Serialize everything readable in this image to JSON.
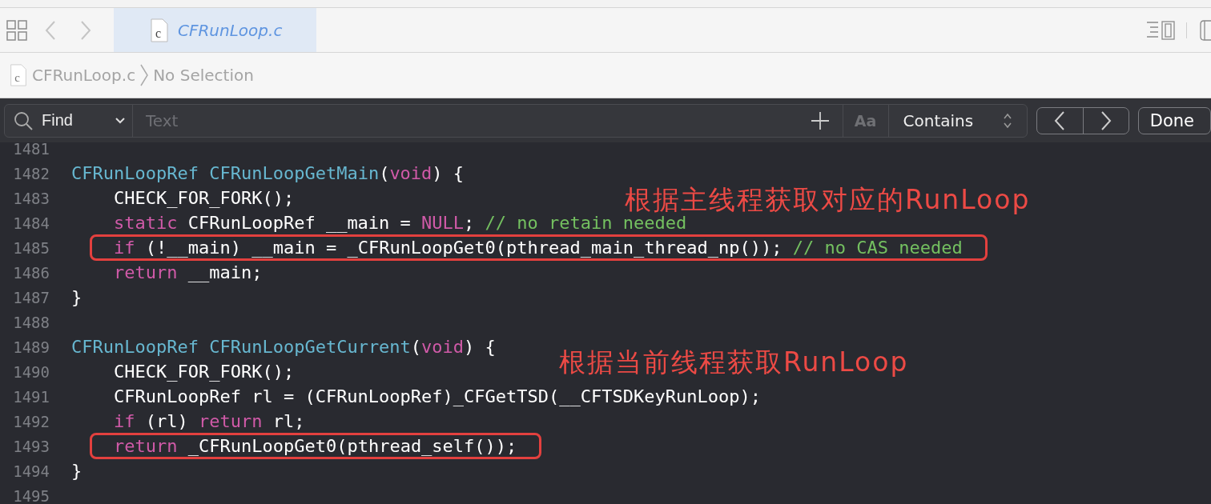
{
  "tab_bar": {
    "back": {
      "disabled": true
    },
    "forward": {
      "disabled": true
    },
    "tabs": [
      {
        "label": "CFRunLoop.c",
        "icon_letter": "c",
        "selected": true
      }
    ]
  },
  "breadcrumb": {
    "icon_letter": "c",
    "items": [
      "CFRunLoop.c",
      "No Selection"
    ]
  },
  "find_bar": {
    "mode": "Find",
    "placeholder": "Text",
    "case_button": "Aa",
    "match": "Contains",
    "done": "Done"
  },
  "editor": {
    "lines": [
      {
        "number": "1481",
        "highlighted": false
      },
      {
        "number": "1482",
        "highlighted": false,
        "tokens": [
          {
            "kind": "type",
            "text": "CFRunLoopRef"
          },
          {
            "kind": "type",
            "text": " CFRunLoopGetMain"
          },
          {
            "kind": "plain",
            "text": "("
          },
          {
            "kind": "keyword",
            "text": "void"
          },
          {
            "kind": "plain",
            "text": ") {"
          }
        ]
      },
      {
        "number": "1483",
        "highlighted": false,
        "tokens": [
          {
            "kind": "plain",
            "text": "    CHECK_FOR_FORK();"
          }
        ]
      },
      {
        "number": "1484",
        "highlighted": false,
        "tokens": [
          {
            "kind": "keyword",
            "text": "    static"
          },
          {
            "kind": "plain",
            "text": " CFRunLoopRef __main = "
          },
          {
            "kind": "keyword",
            "text": "NULL"
          },
          {
            "kind": "plain",
            "text": ";"
          },
          {
            "kind": "comment",
            "text": " // no retain needed"
          }
        ]
      },
      {
        "number": "1485",
        "highlighted": true,
        "tokens": [
          {
            "kind": "keyword",
            "text": "    if"
          },
          {
            "kind": "plain",
            "text": " (!__main) __main = _CFRunLoopGet0(pthread_main_thread_np());"
          },
          {
            "kind": "comment",
            "text": " // no CAS needed"
          }
        ]
      },
      {
        "number": "1486",
        "highlighted": false,
        "tokens": [
          {
            "kind": "keyword",
            "text": "    return"
          },
          {
            "kind": "plain",
            "text": " __main;"
          }
        ]
      },
      {
        "number": "1487",
        "highlighted": false,
        "tokens": [
          {
            "kind": "plain",
            "text": "}"
          }
        ]
      },
      {
        "number": "1488",
        "highlighted": false
      },
      {
        "number": "1489",
        "highlighted": false,
        "tokens": [
          {
            "kind": "type",
            "text": "CFRunLoopRef"
          },
          {
            "kind": "type",
            "text": " CFRunLoopGetCurrent"
          },
          {
            "kind": "plain",
            "text": "("
          },
          {
            "kind": "keyword",
            "text": "void"
          },
          {
            "kind": "plain",
            "text": ") {"
          }
        ]
      },
      {
        "number": "1490",
        "highlighted": false,
        "tokens": [
          {
            "kind": "plain",
            "text": "    CHECK_FOR_FORK();"
          }
        ]
      },
      {
        "number": "1491",
        "highlighted": false,
        "tokens": [
          {
            "kind": "plain",
            "text": "    CFRunLoopRef rl = (CFRunLoopRef)_CFGetTSD(__CFTSDKeyRunLoop);"
          }
        ]
      },
      {
        "number": "1492",
        "highlighted": false,
        "tokens": [
          {
            "kind": "keyword",
            "text": "    if"
          },
          {
            "kind": "plain",
            "text": " (rl) "
          },
          {
            "kind": "keyword",
            "text": "return"
          },
          {
            "kind": "plain",
            "text": " rl;"
          }
        ]
      },
      {
        "number": "1493",
        "highlighted": true,
        "tokens": [
          {
            "kind": "keyword",
            "text": "    return"
          },
          {
            "kind": "plain",
            "text": " _CFRunLoopGet0(pthread_self());"
          }
        ]
      },
      {
        "number": "1494",
        "highlighted": false,
        "tokens": [
          {
            "kind": "plain",
            "text": "}"
          }
        ]
      },
      {
        "number": "1495",
        "highlighted": false
      }
    ],
    "annotations": [
      "根据主线程获取对应的RunLoop",
      "根据当前线程获取RunLoop"
    ]
  }
}
